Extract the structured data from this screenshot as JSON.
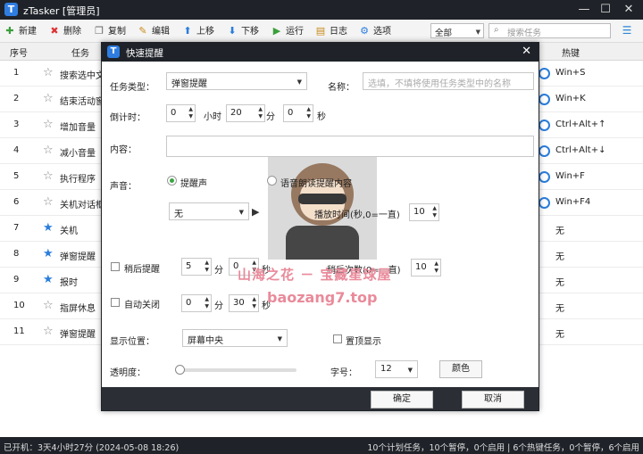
{
  "app": {
    "title": "zTasker [管理员]",
    "logo": "T"
  },
  "window_controls": {
    "minimize": "—",
    "maximize": "☐",
    "close": "✕"
  },
  "toolbar": {
    "items": [
      {
        "label": "新建",
        "icon": "plus-icon",
        "glyph": "✚"
      },
      {
        "label": "删除",
        "icon": "delete-icon",
        "glyph": "✖"
      },
      {
        "label": "复制",
        "icon": "copy-icon",
        "glyph": "❐"
      },
      {
        "label": "编辑",
        "icon": "edit-icon",
        "glyph": "✎"
      },
      {
        "label": "上移",
        "icon": "arrow-up-icon",
        "glyph": "⬆"
      },
      {
        "label": "下移",
        "icon": "arrow-down-icon",
        "glyph": "⬇"
      },
      {
        "label": "运行",
        "icon": "play-icon",
        "glyph": "▶"
      },
      {
        "label": "日志",
        "icon": "log-icon",
        "glyph": "▤"
      },
      {
        "label": "选项",
        "icon": "gear-icon",
        "glyph": "⚙"
      }
    ],
    "filter_value": "全部",
    "search_placeholder": "搜索任务"
  },
  "table": {
    "headers": {
      "no": "序号",
      "task": "任务",
      "hotkey": "热键"
    },
    "rows": [
      {
        "no": "1",
        "name": "搜索选中文本",
        "starred": false,
        "hotkey": "Win+S",
        "toggle": true
      },
      {
        "no": "2",
        "name": "结束活动窗口",
        "starred": false,
        "hotkey": "Win+K",
        "toggle": true
      },
      {
        "no": "3",
        "name": "增加音量",
        "starred": false,
        "hotkey": "Ctrl+Alt+↑",
        "toggle": true
      },
      {
        "no": "4",
        "name": "减小音量",
        "starred": false,
        "hotkey": "Ctrl+Alt+↓",
        "toggle": true
      },
      {
        "no": "5",
        "name": "执行程序",
        "starred": false,
        "hotkey": "Win+F",
        "toggle": true
      },
      {
        "no": "6",
        "name": "关机对话框",
        "starred": false,
        "hotkey": "Win+F4",
        "toggle": true
      },
      {
        "no": "7",
        "name": "关机",
        "starred": true,
        "hotkey": "无",
        "toggle": false
      },
      {
        "no": "8",
        "name": "弹窗提醒",
        "starred": true,
        "hotkey": "无",
        "toggle": false
      },
      {
        "no": "9",
        "name": "报时",
        "starred": true,
        "hotkey": "无",
        "toggle": false
      },
      {
        "no": "10",
        "name": "指屏休息",
        "starred": false,
        "hotkey": "无",
        "toggle": false
      },
      {
        "no": "11",
        "name": "弹窗提醒",
        "starred": false,
        "hotkey": "无",
        "toggle": false
      }
    ]
  },
  "status": {
    "uptime": "已开机：3天4小时27分 (2024-05-08 18:26)",
    "summary": "10个计划任务，10个暂停，0个启用 | 6个热键任务，0个暂停，6个启用"
  },
  "dialog": {
    "title": "快速提醒",
    "task_type_label": "任务类型：",
    "task_type_value": "弹窗提醒",
    "name_label": "名称：",
    "name_placeholder": "选填，不填将使用任务类型中的名称",
    "countdown_label": "倒计时：",
    "countdown": {
      "hours": "0",
      "hours_unit": "小时",
      "minutes": "20",
      "minutes_unit": "分",
      "seconds": "0",
      "seconds_unit": "秒"
    },
    "content_label": "内容：",
    "sound_label": "声音：",
    "sound_option_1": "提醒声",
    "sound_option_2": "语音朗读提醒内容",
    "sound_value": "无",
    "play_duration_label": "播放时间(秒,0=一直)",
    "play_duration_value": "10",
    "snooze_label": "稍后提醒",
    "snooze_minutes": "5",
    "snooze_unit": "分",
    "snooze_seconds": "0",
    "snooze_seconds_unit": "秒",
    "snooze_count_label": "稍后次数(0=一直)",
    "snooze_count_value": "10",
    "auto_close_label": "自动关闭",
    "auto_close_minutes": "0",
    "auto_close_unit": "分",
    "auto_close_seconds": "30",
    "auto_close_seconds_unit": "秒",
    "position_label": "显示位置：",
    "position_value": "屏幕中央",
    "topmost_label": "置顶显示",
    "opacity_label": "透明度：",
    "opacity_value": 0.0,
    "font_size_label": "字号：",
    "font_size_value": "12",
    "color_button": "颜色",
    "ok_button": "确定",
    "cancel_button": "取消"
  },
  "watermark": {
    "line1": "山海之花 － 宝藏星球屋",
    "line2": "baozang7.top"
  },
  "colors": {
    "accent": "#2a7ddc",
    "dark": "#1f2329",
    "radio_on": "#3ba545"
  }
}
